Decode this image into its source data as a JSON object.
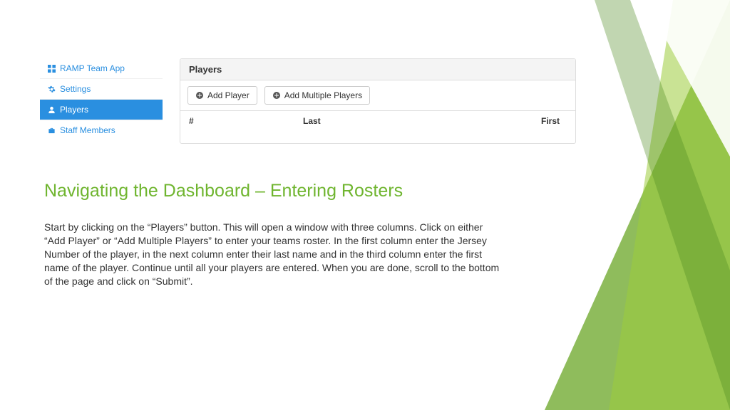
{
  "sidebar": {
    "items": [
      {
        "label": "RAMP Team App"
      },
      {
        "label": "Settings"
      },
      {
        "label": "Players"
      },
      {
        "label": "Staff Members"
      }
    ]
  },
  "pane": {
    "title": "Players",
    "add_label": "Add Player",
    "add_multi_label": "Add Multiple Players",
    "col_number": "#",
    "col_last": "Last",
    "col_first": "First"
  },
  "slide": {
    "title": "Navigating the Dashboard – Entering Rosters",
    "body": "Start by clicking on the “Players” button. This will open a window with three columns. Click on either “Add Player” or “Add Multiple Players” to enter your teams roster. In the first column enter the Jersey Number of the player, in the next column enter their last name and in the third column enter the first name of the player. Continue until all your players are entered. When you are done, scroll to the bottom of the page and click on “Submit”."
  },
  "colors": {
    "accent_green": "#6fb52f",
    "link_blue": "#2a8fe0"
  }
}
